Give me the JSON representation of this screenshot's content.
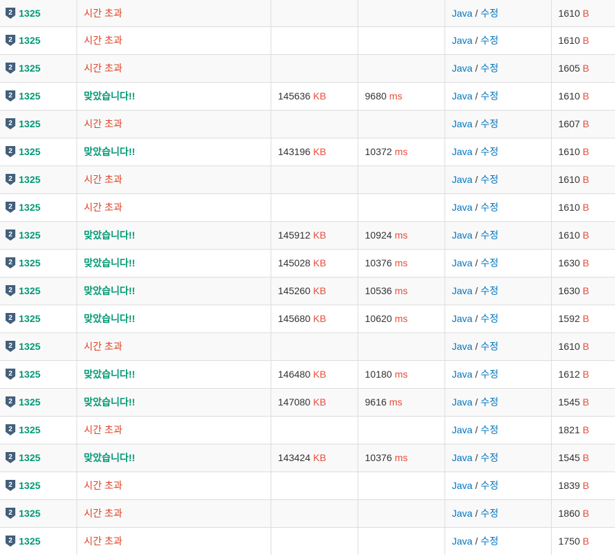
{
  "rows": [
    {
      "problem": "1325",
      "result": "시간 초과",
      "memory": "",
      "time": "",
      "language": "Java",
      "edit": "수정",
      "length": "1610"
    },
    {
      "problem": "1325",
      "result": "시간 초과",
      "memory": "",
      "time": "",
      "language": "Java",
      "edit": "수정",
      "length": "1610"
    },
    {
      "problem": "1325",
      "result": "시간 초과",
      "memory": "",
      "time": "",
      "language": "Java",
      "edit": "수정",
      "length": "1605"
    },
    {
      "problem": "1325",
      "result": "맞았습니다!!",
      "memory": "145636",
      "time": "9680",
      "language": "Java",
      "edit": "수정",
      "length": "1610"
    },
    {
      "problem": "1325",
      "result": "시간 초과",
      "memory": "",
      "time": "",
      "language": "Java",
      "edit": "수정",
      "length": "1607"
    },
    {
      "problem": "1325",
      "result": "맞았습니다!!",
      "memory": "143196",
      "time": "10372",
      "language": "Java",
      "edit": "수정",
      "length": "1610"
    },
    {
      "problem": "1325",
      "result": "시간 초과",
      "memory": "",
      "time": "",
      "language": "Java",
      "edit": "수정",
      "length": "1610"
    },
    {
      "problem": "1325",
      "result": "시간 초과",
      "memory": "",
      "time": "",
      "language": "Java",
      "edit": "수정",
      "length": "1610"
    },
    {
      "problem": "1325",
      "result": "맞았습니다!!",
      "memory": "145912",
      "time": "10924",
      "language": "Java",
      "edit": "수정",
      "length": "1610"
    },
    {
      "problem": "1325",
      "result": "맞았습니다!!",
      "memory": "145028",
      "time": "10376",
      "language": "Java",
      "edit": "수정",
      "length": "1630"
    },
    {
      "problem": "1325",
      "result": "맞았습니다!!",
      "memory": "145260",
      "time": "10536",
      "language": "Java",
      "edit": "수정",
      "length": "1630"
    },
    {
      "problem": "1325",
      "result": "맞았습니다!!",
      "memory": "145680",
      "time": "10620",
      "language": "Java",
      "edit": "수정",
      "length": "1592"
    },
    {
      "problem": "1325",
      "result": "시간 초과",
      "memory": "",
      "time": "",
      "language": "Java",
      "edit": "수정",
      "length": "1610"
    },
    {
      "problem": "1325",
      "result": "맞았습니다!!",
      "memory": "146480",
      "time": "10180",
      "language": "Java",
      "edit": "수정",
      "length": "1612"
    },
    {
      "problem": "1325",
      "result": "맞았습니다!!",
      "memory": "147080",
      "time": "9616",
      "language": "Java",
      "edit": "수정",
      "length": "1545"
    },
    {
      "problem": "1325",
      "result": "시간 초과",
      "memory": "",
      "time": "",
      "language": "Java",
      "edit": "수정",
      "length": "1821"
    },
    {
      "problem": "1325",
      "result": "맞았습니다!!",
      "memory": "143424",
      "time": "10376",
      "language": "Java",
      "edit": "수정",
      "length": "1545"
    },
    {
      "problem": "1325",
      "result": "시간 초과",
      "memory": "",
      "time": "",
      "language": "Java",
      "edit": "수정",
      "length": "1839"
    },
    {
      "problem": "1325",
      "result": "시간 초과",
      "memory": "",
      "time": "",
      "language": "Java",
      "edit": "수정",
      "length": "1860"
    },
    {
      "problem": "1325",
      "result": "시간 초과",
      "memory": "",
      "time": "",
      "language": "Java",
      "edit": "수정",
      "length": "1750"
    }
  ],
  "units": {
    "memory": "KB",
    "time": "ms",
    "length": "B"
  },
  "language_separator": "/",
  "tier": {
    "icon": "silver-2-tier-icon",
    "digit": "2",
    "color": "#435f7a"
  },
  "colors": {
    "accepted": "#009874",
    "tle": "#dd4124",
    "unit": "#e74c3c",
    "link": "#0076c0",
    "border": "#dddddd",
    "stripe": "#f9f9f9"
  }
}
